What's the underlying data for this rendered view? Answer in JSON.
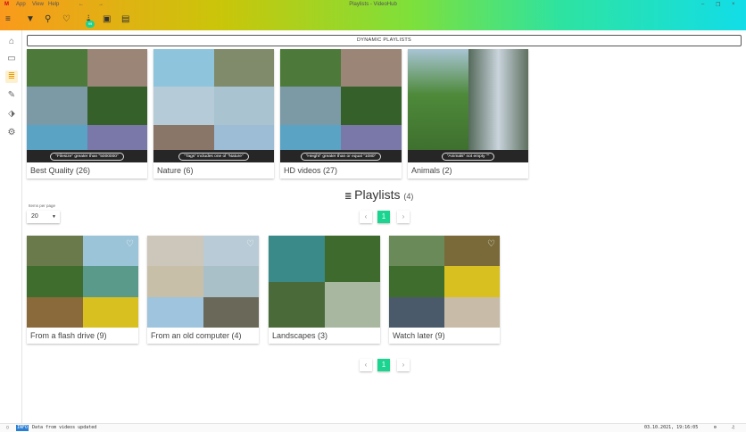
{
  "window": {
    "title": "Playlists - VideoHub",
    "menu": [
      "App",
      "View",
      "Help"
    ],
    "nav_back": "←",
    "nav_forward": "→",
    "minimize": "–",
    "restore": "❐",
    "close": "×"
  },
  "toolbar": {
    "icons": [
      "menu-icon",
      "filter-icon",
      "search-icon",
      "heart-icon",
      "download-icon",
      "crop-icon",
      "folder-image-icon"
    ],
    "badge": "99"
  },
  "sidebar": {
    "items": [
      "home",
      "videos",
      "playlists",
      "tools",
      "tags",
      "settings"
    ],
    "active": "playlists"
  },
  "dynamic_playlists": {
    "button": "DYNAMIC PLAYLISTS",
    "items": [
      {
        "name": "Best Quality (26)",
        "filter": "\"Filesize\" greater than \"5000000\""
      },
      {
        "name": "Nature (6)",
        "filter": "\"Tags\" includes one of \"Nature\""
      },
      {
        "name": "HD videos (27)",
        "filter": "\"Height\" greater than or equal \"1080\""
      },
      {
        "name": "Animals (2)",
        "filter": "\"Animals\" not empty \"\""
      }
    ]
  },
  "playlists": {
    "title": "Playlists",
    "count": "(4)",
    "items_per_page_label": "Items per page",
    "items_per_page": "20",
    "page": "1",
    "prev": "‹",
    "next": "›",
    "items": [
      {
        "name": "From a flash drive (9)"
      },
      {
        "name": "From an old computer (4)"
      },
      {
        "name": "Landscapes (3)"
      },
      {
        "name": "Watch later (9)"
      }
    ]
  },
  "status": {
    "level": "INFO",
    "message": "Data from videos updated",
    "timestamp": "03.10.2021, 19:16:05"
  },
  "colors": {
    "accent": "#1bd490",
    "active": "#e69a00"
  }
}
